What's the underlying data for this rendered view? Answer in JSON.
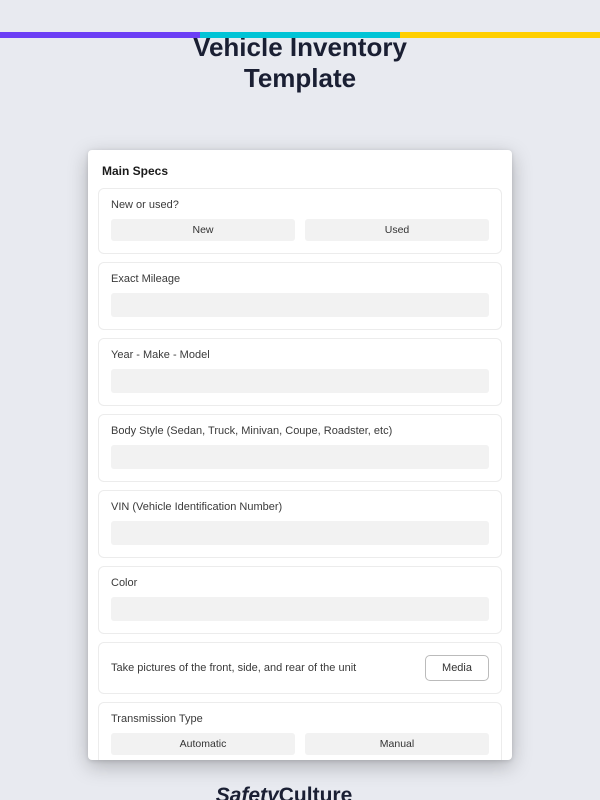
{
  "title_line1": "Vehicle Inventory",
  "title_line2": "Template",
  "section_heading": "Main Specs",
  "fields": {
    "new_or_used": {
      "label": "New or used?",
      "options": [
        "New",
        "Used"
      ]
    },
    "mileage": {
      "label": "Exact Mileage"
    },
    "ymm": {
      "label": "Year - Make - Model"
    },
    "body": {
      "label": "Body Style (Sedan, Truck, Minivan, Coupe, Roadster, etc)"
    },
    "vin": {
      "label": "VIN (Vehicle Identification Number)"
    },
    "color": {
      "label": "Color"
    },
    "pictures": {
      "label": "Take pictures of the front, side, and rear of the unit",
      "button": "Media"
    },
    "transmission": {
      "label": "Transmission Type",
      "options": [
        "Automatic",
        "Manual"
      ]
    }
  },
  "brand": {
    "part1": "Safety",
    "part2": "Culture"
  }
}
